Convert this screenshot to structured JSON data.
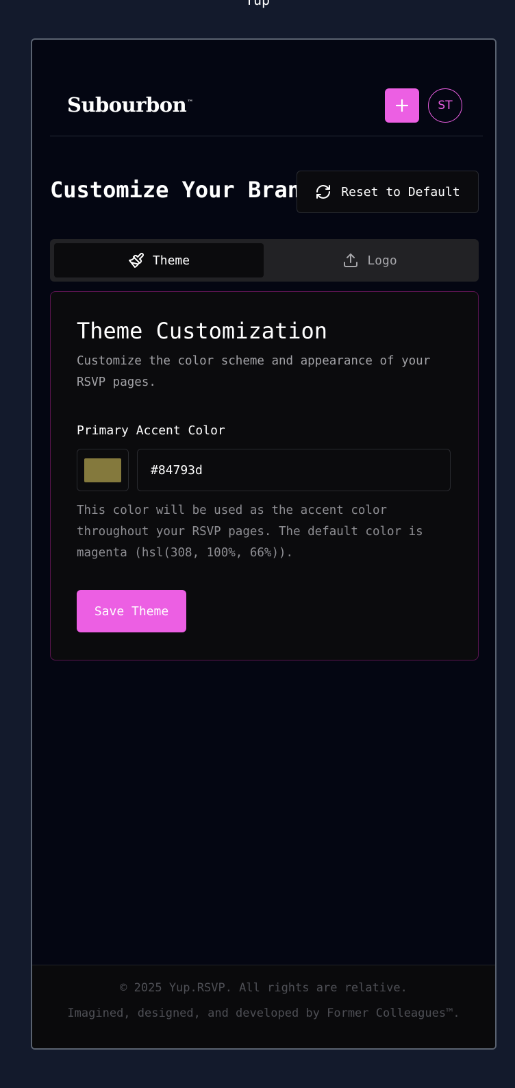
{
  "top_partial_text": "Yup",
  "header": {
    "brand": "Subourbon",
    "brand_tm": "™",
    "avatar_initials": "ST"
  },
  "page": {
    "title": "Customize Your Brand",
    "reset_label": "Reset to Default"
  },
  "tabs": [
    {
      "label": "Theme",
      "icon": "paintbrush-icon",
      "active": true
    },
    {
      "label": "Logo",
      "icon": "upload-icon",
      "active": false
    }
  ],
  "theme_card": {
    "title": "Theme Customization",
    "description": "Customize the color scheme and appearance of your RSVP pages.",
    "field_label": "Primary Accent Color",
    "color_value": "#84793d",
    "help_text": "This color will be used as the accent color throughout your RSVP pages. The default color is magenta (hsl(308, 100%, 66%)).",
    "save_label": "Save Theme"
  },
  "footer": {
    "line1": "© 2025 Yup.RSVP. All rights are relative.",
    "line2": "Imagined, designed, and developed by Former Colleagues™."
  },
  "colors": {
    "accent": "#ec5fe3",
    "background": "#040612",
    "card_border": "#5b154f"
  }
}
